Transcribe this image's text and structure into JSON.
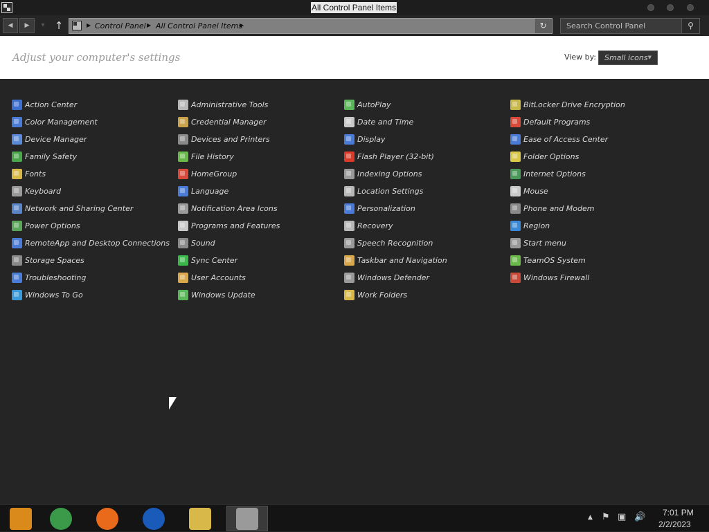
{
  "window": {
    "title": "All Control Panel Items"
  },
  "address": {
    "breadcrumbs": [
      "Control Panel",
      "All Control Panel Items"
    ],
    "search_placeholder": "Search Control Panel"
  },
  "header": {
    "heading": "Adjust your computer's settings",
    "view_by_label": "View by:",
    "view_by_value": "Small icons"
  },
  "items": [
    [
      {
        "label": "Action Center",
        "icon": "flag-icon",
        "color": "#3d6fd1"
      },
      {
        "label": "Color Management",
        "icon": "monitor-color-icon",
        "color": "#4a7bd6"
      },
      {
        "label": "Device Manager",
        "icon": "device-manager-icon",
        "color": "#5b8ad8"
      },
      {
        "label": "Family Safety",
        "icon": "family-safety-icon",
        "color": "#4aa64a"
      },
      {
        "label": "Fonts",
        "icon": "fonts-folder-icon",
        "color": "#d9b84a"
      },
      {
        "label": "Keyboard",
        "icon": "keyboard-icon",
        "color": "#9a9a9a"
      },
      {
        "label": "Network and Sharing Center",
        "icon": "network-icon",
        "color": "#5a84c8"
      },
      {
        "label": "Power Options",
        "icon": "power-icon",
        "color": "#5aa65a"
      },
      {
        "label": "RemoteApp and Desktop Connections",
        "icon": "remote-desktop-icon",
        "color": "#4a7bd6"
      },
      {
        "label": "Storage Spaces",
        "icon": "storage-icon",
        "color": "#8a8a8a"
      },
      {
        "label": "Troubleshooting",
        "icon": "troubleshooting-icon",
        "color": "#4a7bd6"
      },
      {
        "label": "Windows To Go",
        "icon": "windows-to-go-icon",
        "color": "#3a9ad9"
      }
    ],
    [
      {
        "label": "Administrative Tools",
        "icon": "admin-tools-icon",
        "color": "#b8b8b8"
      },
      {
        "label": "Credential Manager",
        "icon": "credential-icon",
        "color": "#c9a24a"
      },
      {
        "label": "Devices and Printers",
        "icon": "printer-icon",
        "color": "#8a8a8a"
      },
      {
        "label": "File History",
        "icon": "file-history-icon",
        "color": "#6ab84a"
      },
      {
        "label": "HomeGroup",
        "icon": "homegroup-icon",
        "color": "#d94a3a"
      },
      {
        "label": "Language",
        "icon": "language-icon",
        "color": "#4a7bd6"
      },
      {
        "label": "Notification Area Icons",
        "icon": "notification-icon",
        "color": "#9a9a9a"
      },
      {
        "label": "Programs and Features",
        "icon": "programs-icon",
        "color": "#c9c9c9"
      },
      {
        "label": "Sound",
        "icon": "sound-icon",
        "color": "#8a8a8a"
      },
      {
        "label": "Sync Center",
        "icon": "sync-icon",
        "color": "#3ab84a"
      },
      {
        "label": "User Accounts",
        "icon": "user-accounts-icon",
        "color": "#d9a84a"
      },
      {
        "label": "Windows Update",
        "icon": "windows-update-icon",
        "color": "#5ab85a"
      }
    ],
    [
      {
        "label": "AutoPlay",
        "icon": "autoplay-icon",
        "color": "#5ab85a"
      },
      {
        "label": "Date and Time",
        "icon": "clock-icon",
        "color": "#c9c9c9"
      },
      {
        "label": "Display",
        "icon": "display-icon",
        "color": "#4a7bd6"
      },
      {
        "label": "Flash Player (32-bit)",
        "icon": "flash-icon",
        "color": "#d93a2a"
      },
      {
        "label": "Indexing Options",
        "icon": "indexing-icon",
        "color": "#9a9a9a"
      },
      {
        "label": "Location Settings",
        "icon": "location-icon",
        "color": "#b8b8b8"
      },
      {
        "label": "Personalization",
        "icon": "personalization-icon",
        "color": "#4a7bd6"
      },
      {
        "label": "Recovery",
        "icon": "recovery-icon",
        "color": "#b8b8b8"
      },
      {
        "label": "Speech Recognition",
        "icon": "microphone-icon",
        "color": "#9a9a9a"
      },
      {
        "label": "Taskbar and Navigation",
        "icon": "taskbar-icon",
        "color": "#d9a84a"
      },
      {
        "label": "Windows Defender",
        "icon": "defender-icon",
        "color": "#9a9a9a"
      },
      {
        "label": "Work Folders",
        "icon": "work-folders-icon",
        "color": "#d9b84a"
      }
    ],
    [
      {
        "label": "BitLocker Drive Encryption",
        "icon": "bitlocker-icon",
        "color": "#c9b84a"
      },
      {
        "label": "Default Programs",
        "icon": "default-programs-icon",
        "color": "#d94a3a"
      },
      {
        "label": "Ease of Access Center",
        "icon": "ease-of-access-icon",
        "color": "#4a7bd6"
      },
      {
        "label": "Folder Options",
        "icon": "folder-icon",
        "color": "#d9c84a"
      },
      {
        "label": "Internet Options",
        "icon": "internet-icon",
        "color": "#4a9a5a"
      },
      {
        "label": "Mouse",
        "icon": "mouse-icon",
        "color": "#c9c9c9"
      },
      {
        "label": "Phone and Modem",
        "icon": "phone-icon",
        "color": "#8a8a8a"
      },
      {
        "label": "Region",
        "icon": "region-icon",
        "color": "#3a8ad9"
      },
      {
        "label": "Start menu",
        "icon": "start-menu-icon",
        "color": "#9a9a9a"
      },
      {
        "label": "TeamOS System",
        "icon": "teamos-icon",
        "color": "#6ab84a"
      },
      {
        "label": "Windows Firewall",
        "icon": "firewall-icon",
        "color": "#c94a3a"
      }
    ]
  ],
  "taskbar": {
    "apps": [
      {
        "name": "chrome-canary-icon",
        "color": "#d98a1a",
        "active": false
      },
      {
        "name": "chrome-icon",
        "color": "#3a9a4a",
        "active": false
      },
      {
        "name": "firefox-icon",
        "color": "#e86a1a",
        "active": false
      },
      {
        "name": "obama-logo-icon",
        "color": "#1a5ab8",
        "active": false
      },
      {
        "name": "file-explorer-icon",
        "color": "#d9b84a",
        "active": false
      },
      {
        "name": "control-panel-icon",
        "color": "#9a9a9a",
        "active": true
      }
    ],
    "time": "7:01 PM",
    "date": "2/2/2023"
  }
}
